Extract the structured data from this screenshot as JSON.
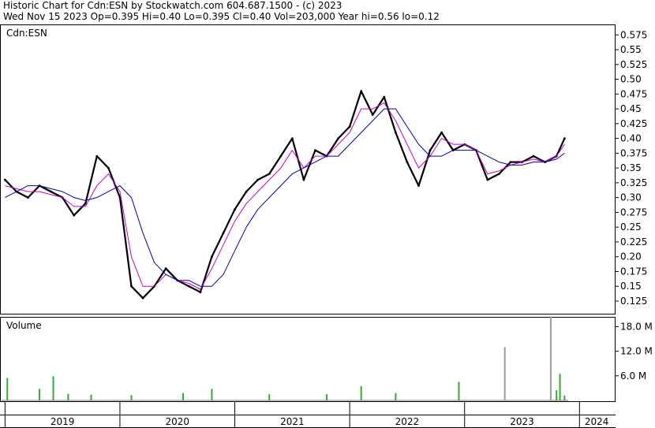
{
  "header": {
    "line1": "Historic Chart for Cdn:ESN by Stockwatch.com 604.687.1500 - (c) 2023",
    "line2": "Wed Nov 15 2023   Op=0.395  Hi=0.40  Lo=0.395  Cl=0.40  Vol=203,000   Year hi=0.56  lo=0.12"
  },
  "price_panel_label": "Cdn:ESN",
  "volume_panel_label": "Volume",
  "chart_data": [
    {
      "type": "line",
      "title": "Cdn:ESN",
      "y_ticks": [
        "0.575",
        "0.55",
        "0.525",
        "0.50",
        "0.475",
        "0.45",
        "0.425",
        "0.40",
        "0.375",
        "0.35",
        "0.325",
        "0.30",
        "0.275",
        "0.25",
        "0.225",
        "0.20",
        "0.175",
        "0.15",
        "0.125"
      ],
      "ylim": [
        0.105,
        0.59
      ],
      "x_ticks": [
        "2019",
        "2020",
        "2021",
        "2022",
        "2023",
        "2024"
      ],
      "x": [
        2019.0,
        2019.1,
        2019.2,
        2019.3,
        2019.4,
        2019.5,
        2019.6,
        2019.7,
        2019.8,
        2019.9,
        2020.0,
        2020.1,
        2020.2,
        2020.3,
        2020.4,
        2020.5,
        2020.6,
        2020.7,
        2020.8,
        2020.9,
        2021.0,
        2021.1,
        2021.2,
        2021.3,
        2021.4,
        2021.5,
        2021.6,
        2021.7,
        2021.8,
        2021.9,
        2022.0,
        2022.1,
        2022.2,
        2022.3,
        2022.4,
        2022.5,
        2022.6,
        2022.7,
        2022.8,
        2022.9,
        2023.0,
        2023.1,
        2023.2,
        2023.3,
        2023.4,
        2023.5,
        2023.6,
        2023.7,
        2023.8,
        2023.87
      ],
      "series": [
        {
          "name": "",
          "values": [
            0.33,
            0.31,
            0.3,
            0.32,
            0.31,
            0.3,
            0.27,
            0.29,
            0.37,
            0.35,
            0.3,
            0.15,
            0.13,
            0.15,
            0.18,
            0.16,
            0.15,
            0.14,
            0.2,
            0.24,
            0.28,
            0.31,
            0.33,
            0.34,
            0.37,
            0.4,
            0.33,
            0.38,
            0.37,
            0.4,
            0.42,
            0.48,
            0.44,
            0.47,
            0.41,
            0.36,
            0.32,
            0.38,
            0.41,
            0.38,
            0.39,
            0.38,
            0.33,
            0.34,
            0.36,
            0.36,
            0.37,
            0.36,
            0.37,
            0.4
          ]
        },
        {
          "name": "",
          "values": [
            0.32,
            0.315,
            0.31,
            0.31,
            0.305,
            0.3,
            0.285,
            0.285,
            0.32,
            0.34,
            0.31,
            0.2,
            0.15,
            0.15,
            0.17,
            0.16,
            0.155,
            0.145,
            0.18,
            0.22,
            0.26,
            0.29,
            0.31,
            0.33,
            0.35,
            0.38,
            0.35,
            0.37,
            0.37,
            0.39,
            0.41,
            0.45,
            0.45,
            0.46,
            0.43,
            0.39,
            0.35,
            0.37,
            0.4,
            0.39,
            0.39,
            0.38,
            0.34,
            0.345,
            0.355,
            0.36,
            0.365,
            0.36,
            0.37,
            0.39
          ]
        },
        {
          "name": "",
          "values": [
            0.3,
            0.31,
            0.32,
            0.32,
            0.315,
            0.31,
            0.3,
            0.295,
            0.3,
            0.31,
            0.32,
            0.3,
            0.24,
            0.19,
            0.17,
            0.16,
            0.16,
            0.15,
            0.15,
            0.17,
            0.21,
            0.25,
            0.28,
            0.3,
            0.32,
            0.34,
            0.35,
            0.36,
            0.37,
            0.37,
            0.39,
            0.41,
            0.43,
            0.45,
            0.45,
            0.42,
            0.39,
            0.37,
            0.37,
            0.38,
            0.38,
            0.38,
            0.37,
            0.36,
            0.355,
            0.355,
            0.36,
            0.36,
            0.365,
            0.375
          ]
        }
      ]
    },
    {
      "type": "bar",
      "title": "Volume",
      "y_ticks": [
        "18.0 M",
        "12.0 M",
        "6.0 M"
      ],
      "ylim": [
        0,
        20
      ],
      "x": [
        2019.02,
        2019.3,
        2019.42,
        2019.55,
        2019.75,
        2020.1,
        2020.55,
        2020.8,
        2021.3,
        2021.8,
        2022.1,
        2022.4,
        2022.95,
        2023.35,
        2023.75,
        2023.8,
        2023.83,
        2023.87
      ],
      "values": [
        5.5,
        2.8,
        5.9,
        1.6,
        1.4,
        1.3,
        1.8,
        2.8,
        1.5,
        1.5,
        3.5,
        1.8,
        4.5,
        13.0,
        20.5,
        2.5,
        6.5,
        1.2
      ]
    }
  ]
}
